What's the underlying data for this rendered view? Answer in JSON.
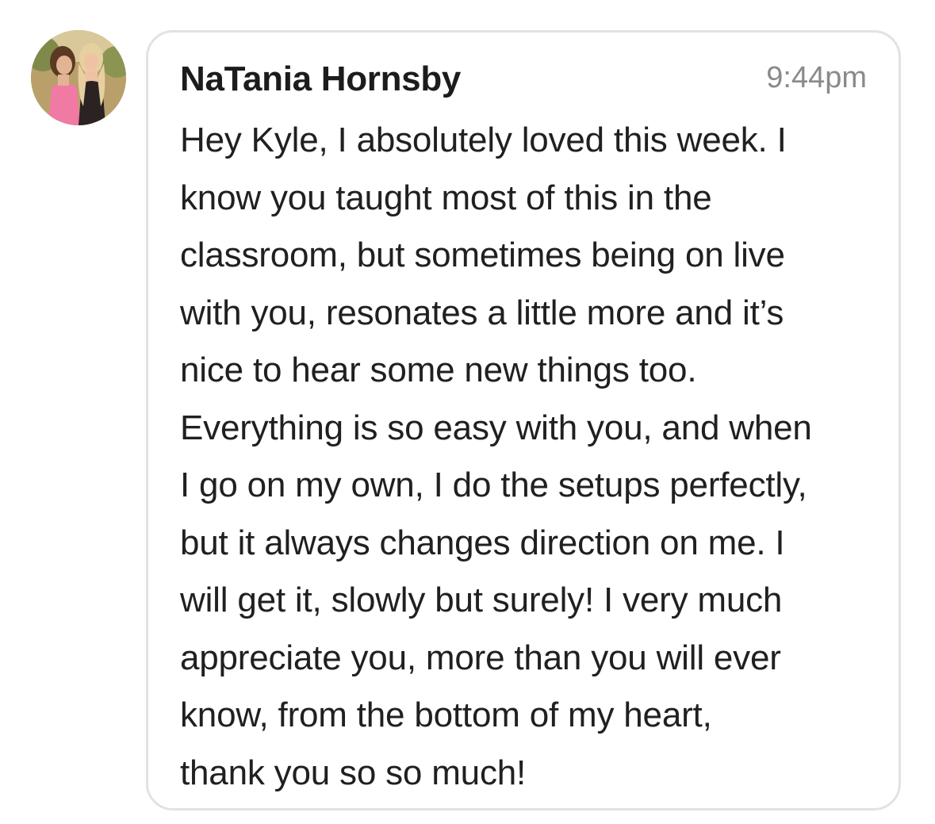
{
  "message": {
    "sender_name": "NaTania Hornsby",
    "timestamp": "9:44pm",
    "avatar_icon": "profile-photo-avatar",
    "lines": [
      "Hey Kyle, I absolutely loved this week. I",
      "know you taught most of this in the",
      "classroom, but sometimes being on live",
      "with you, resonates a little more and it’s",
      "nice to hear some new things too.",
      "Everything is so easy with you, and when",
      "I go on my own, I do the setups perfectly,",
      "but it always changes direction on me. I",
      "will get it, slowly but surely! I very much",
      "appreciate you, more than you will ever",
      "know, from the bottom of my heart,",
      "thank you so so much!"
    ]
  },
  "colors": {
    "bubble_border": "#e2e2e2",
    "text": "#202020",
    "timestamp": "#8a8a8a"
  }
}
